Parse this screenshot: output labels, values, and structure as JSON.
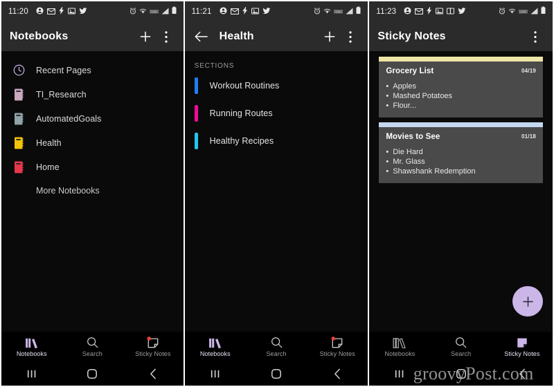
{
  "colors": {
    "appbar": "#2b2b2b",
    "body": "#0a0a0a",
    "accent_purple": "#cbb6e8",
    "note_body": "#4a4a4a",
    "inactive_label": "#9e9e9e"
  },
  "screens": [
    {
      "id": "notebooks",
      "statusbar": {
        "time": "11:20",
        "left_icons": [
          "account-icon",
          "mail-icon",
          "flash-icon",
          "photo-icon",
          "twitter-icon"
        ],
        "right_icons": [
          "alarm-icon",
          "wifi-icon",
          "lte-icon",
          "signal-icon",
          "battery-icon"
        ]
      },
      "appbar": {
        "title": "Notebooks",
        "has_back": false,
        "actions": [
          "add-icon",
          "overflow-menu-icon"
        ]
      },
      "list": [
        {
          "label": "Recent Pages",
          "icon": "clock-icon",
          "color": "#cbb6e8"
        },
        {
          "label": "TI_Research",
          "icon": "notebook-icon",
          "color": "#c9a8c0"
        },
        {
          "label": "AutomatedGoals",
          "icon": "notebook-icon",
          "color": "#8fa3a8"
        },
        {
          "label": "Health",
          "icon": "notebook-icon",
          "color": "#f2c409"
        },
        {
          "label": "Home",
          "icon": "notebook-icon",
          "color": "#e5384a"
        }
      ],
      "more_label": "More Notebooks",
      "bottomnav": [
        {
          "label": "Notebooks",
          "icon": "books-icon",
          "active": true
        },
        {
          "label": "Search",
          "icon": "search-icon",
          "active": false
        },
        {
          "label": "Sticky Notes",
          "icon": "sticky-note-icon",
          "active": false,
          "badge": true
        }
      ],
      "gesture": [
        "recents-icon",
        "home-icon",
        "back-icon"
      ],
      "watermark": ""
    },
    {
      "id": "health",
      "statusbar": {
        "time": "11:21",
        "left_icons": [
          "account-icon",
          "mail-icon",
          "flash-icon",
          "photo-icon",
          "twitter-icon"
        ],
        "right_icons": [
          "alarm-icon",
          "wifi-icon",
          "lte-icon",
          "signal-icon",
          "battery-icon"
        ]
      },
      "appbar": {
        "title": "Health",
        "has_back": true,
        "actions": [
          "add-icon",
          "overflow-menu-icon"
        ]
      },
      "sections_header": "SECTIONS",
      "sections": [
        {
          "label": "Workout Routines",
          "color": "#1f7ef5"
        },
        {
          "label": "Running Routes",
          "color": "#f00a9b"
        },
        {
          "label": "Healthy Recipes",
          "color": "#1fc7f5"
        }
      ],
      "bottomnav": [
        {
          "label": "Notebooks",
          "icon": "books-icon",
          "active": true
        },
        {
          "label": "Search",
          "icon": "search-icon",
          "active": false
        },
        {
          "label": "Sticky Notes",
          "icon": "sticky-note-icon",
          "active": false,
          "badge": true
        }
      ],
      "gesture": [
        "recents-icon",
        "home-icon",
        "back-icon"
      ],
      "watermark": ""
    },
    {
      "id": "sticky-notes",
      "statusbar": {
        "time": "11:23",
        "left_icons": [
          "account-icon",
          "mail-icon",
          "flash-icon",
          "photo-icon",
          "book-icon",
          "twitter-icon"
        ],
        "right_icons": [
          "alarm-icon",
          "wifi-icon",
          "lte-icon",
          "signal-icon",
          "battery-icon"
        ]
      },
      "appbar": {
        "title": "Sticky Notes",
        "has_back": false,
        "actions": [
          "overflow-menu-icon"
        ]
      },
      "notes": [
        {
          "title": "Grocery List",
          "date": "04/19",
          "strip_color": "#ece5a6",
          "items": [
            "Apples",
            "Mashed Potatoes",
            "Flour..."
          ]
        },
        {
          "title": "Movies to See",
          "date": "01/18",
          "strip_color": "#c4d8f0",
          "items": [
            "Die Hard",
            "Mr. Glass",
            "Shawshank Redemption"
          ]
        }
      ],
      "fab": {
        "icon": "add-icon",
        "label": "+"
      },
      "bottomnav": [
        {
          "label": "Notebooks",
          "icon": "books-icon",
          "active": false
        },
        {
          "label": "Search",
          "icon": "search-icon",
          "active": false
        },
        {
          "label": "Sticky Notes",
          "icon": "sticky-note-icon",
          "active": true,
          "badge": false
        }
      ],
      "gesture": [
        "recents-icon",
        "home-icon",
        "back-icon"
      ],
      "watermark": "groovyPost.com"
    }
  ]
}
